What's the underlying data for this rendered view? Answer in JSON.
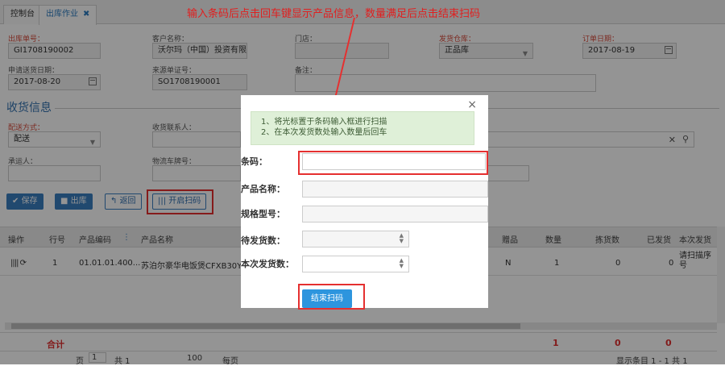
{
  "tabs": [
    {
      "label": "控制台"
    },
    {
      "label": "出库作业",
      "close": "✖"
    }
  ],
  "annotation": "输入条码后点击回车键显示产品信息，数量满足后点击结束扫码",
  "form": {
    "order_no_label": "出库单号：",
    "order_no": "GI1708190002",
    "customer_label": "客户名称：",
    "customer": "沃尔玛（中国）投资有限",
    "store_label": "门店：",
    "warehouse_label": "发货仓库：",
    "warehouse": "正品库",
    "order_date_label": "订单日期：",
    "order_date": "2017-08-19",
    "delivery_date_label": "申请送货日期：",
    "delivery_date": "2017-08-20",
    "source_no_label": "来源单证号：",
    "source_no": "SO1708190001",
    "remark_label": "备注："
  },
  "receive": {
    "section_title": "收货信息",
    "method_label": "配送方式：",
    "method": "配送",
    "contact_label": "收货联系人：",
    "carrier_label": "承运人：",
    "plate_label": "物流车牌号："
  },
  "toolbar": {
    "save": "保存",
    "outbound": "出库",
    "back": "返回",
    "scan": "开启扫码"
  },
  "grid": {
    "headers": [
      "操作",
      "行号",
      "产品编码",
      "产品名称",
      "赠品",
      "数量",
      "拣货数",
      "已发货",
      "本次发货"
    ],
    "row": {
      "line_no": "1",
      "code": "01.01.01.400...",
      "name": "苏泊尔豪华电饭煲CFXB30YB8",
      "gift": "N",
      "qty": "1",
      "picked": "0",
      "shipped": "0",
      "this_ship": "请扫描序号"
    },
    "sum_label": "合计",
    "sum_qty": "1",
    "sum_picked": "0",
    "sum_shipped": "0"
  },
  "pager": {
    "page_prefix": "页",
    "page": "1",
    "total": "共 1",
    "per_page": "100",
    "per_page_suffix": "每页",
    "summary": "显示条目 1 - 1 共 1"
  },
  "modal": {
    "close": "×",
    "tip1": "1、将光标置于条码输入框进行扫描",
    "tip2": "2、在本次发货数处输入数量后回车",
    "barcode_label": "条码：",
    "name_label": "产品名称：",
    "spec_label": "规格型号：",
    "pending_label": "待发货数：",
    "this_label": "本次发货数：",
    "end_button": "结束扫码"
  },
  "colors": {
    "accent": "#2d95de",
    "highlight": "#e53030"
  }
}
